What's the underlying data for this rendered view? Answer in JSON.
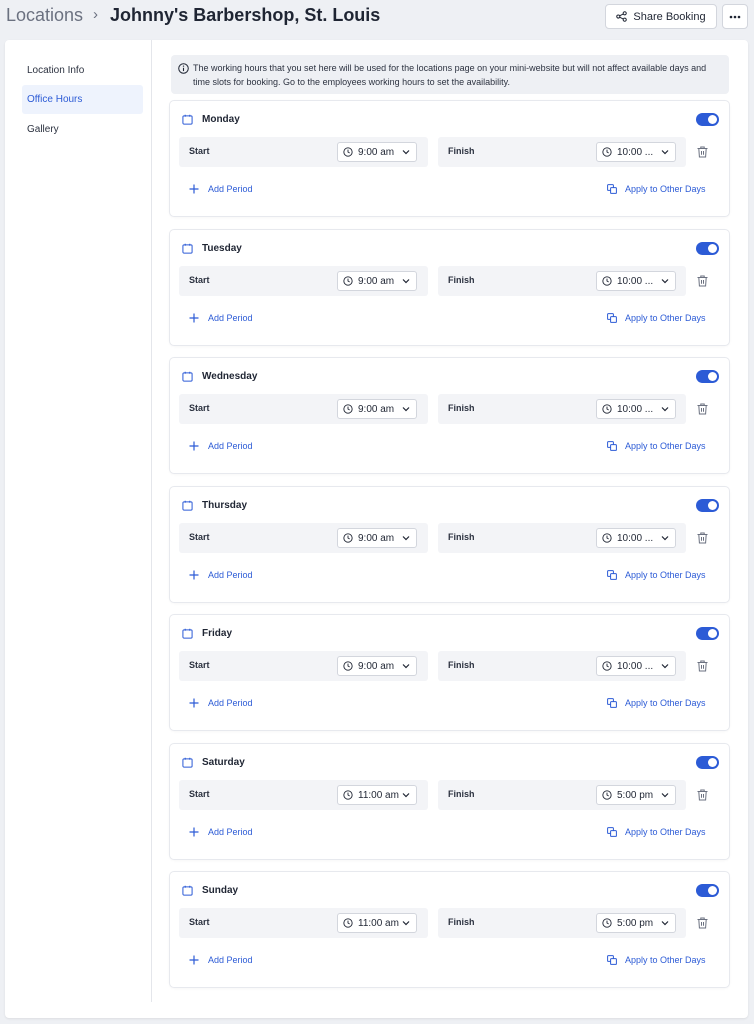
{
  "header": {
    "breadcrumb_root": "Locations",
    "breadcrumb_sep": "›",
    "title": "Johnny's Barbershop, St. Louis",
    "share_label": "Share Booking",
    "more_label": "•••"
  },
  "sidebar": {
    "items": [
      {
        "label": "Location Info",
        "active": false
      },
      {
        "label": "Office Hours",
        "active": true
      },
      {
        "label": "Gallery",
        "active": false
      }
    ]
  },
  "notice": "The working hours that you set here will be used for the locations page on your mini-website but will not affect available days and time slots for booking. Go to the employees working hours to set the availability.",
  "labels": {
    "start": "Start",
    "finish": "Finish",
    "add_period": "Add Period",
    "apply_other": "Apply to Other Days"
  },
  "days": [
    {
      "name": "Monday",
      "enabled": true,
      "start": "9:00 am",
      "finish": "10:00 ..."
    },
    {
      "name": "Tuesday",
      "enabled": true,
      "start": "9:00 am",
      "finish": "10:00 ..."
    },
    {
      "name": "Wednesday",
      "enabled": true,
      "start": "9:00 am",
      "finish": "10:00 ..."
    },
    {
      "name": "Thursday",
      "enabled": true,
      "start": "9:00 am",
      "finish": "10:00 ..."
    },
    {
      "name": "Friday",
      "enabled": true,
      "start": "9:00 am",
      "finish": "10:00 ..."
    },
    {
      "name": "Saturday",
      "enabled": true,
      "start": "11:00 am",
      "finish": "5:00 pm"
    },
    {
      "name": "Sunday",
      "enabled": true,
      "start": "11:00 am",
      "finish": "5:00 pm"
    }
  ],
  "colors": {
    "accent": "#2c5bd6",
    "background": "#eef0f4",
    "card": "#ffffff"
  }
}
